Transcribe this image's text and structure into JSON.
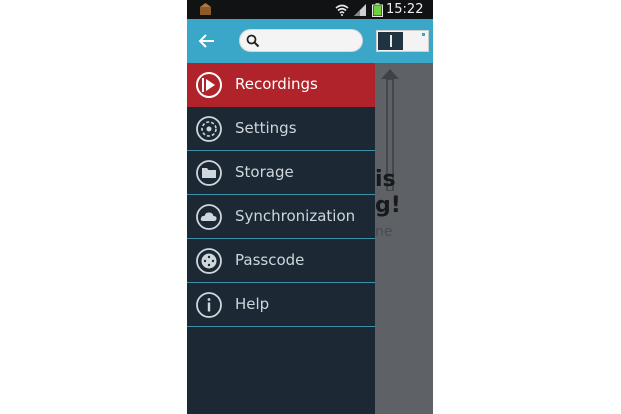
{
  "status_bar": {
    "time": "15:22",
    "icons": [
      "app-notification-icon",
      "wifi-icon",
      "signal-icon",
      "battery-icon"
    ]
  },
  "action_bar": {
    "back_icon": "back-arrow-icon",
    "search": {
      "value": "",
      "placeholder": ""
    },
    "toggle": {
      "state": "on"
    },
    "color": "#3aa7c9"
  },
  "drawer": {
    "items": [
      {
        "label": "Recordings",
        "icon": "play-icon",
        "active": true
      },
      {
        "label": "Settings",
        "icon": "gear-icon",
        "active": false
      },
      {
        "label": "Storage",
        "icon": "folder-icon",
        "active": false
      },
      {
        "label": "Synchronization",
        "icon": "cloud-icon",
        "active": false
      },
      {
        "label": "Passcode",
        "icon": "lock-dial-icon",
        "active": false
      },
      {
        "label": "Help",
        "icon": "info-icon",
        "active": false
      }
    ],
    "active_color": "#b0232b",
    "background_color": "#1c2833"
  },
  "background_content": {
    "line1": "is",
    "line2": "g!",
    "line3": "ne"
  }
}
